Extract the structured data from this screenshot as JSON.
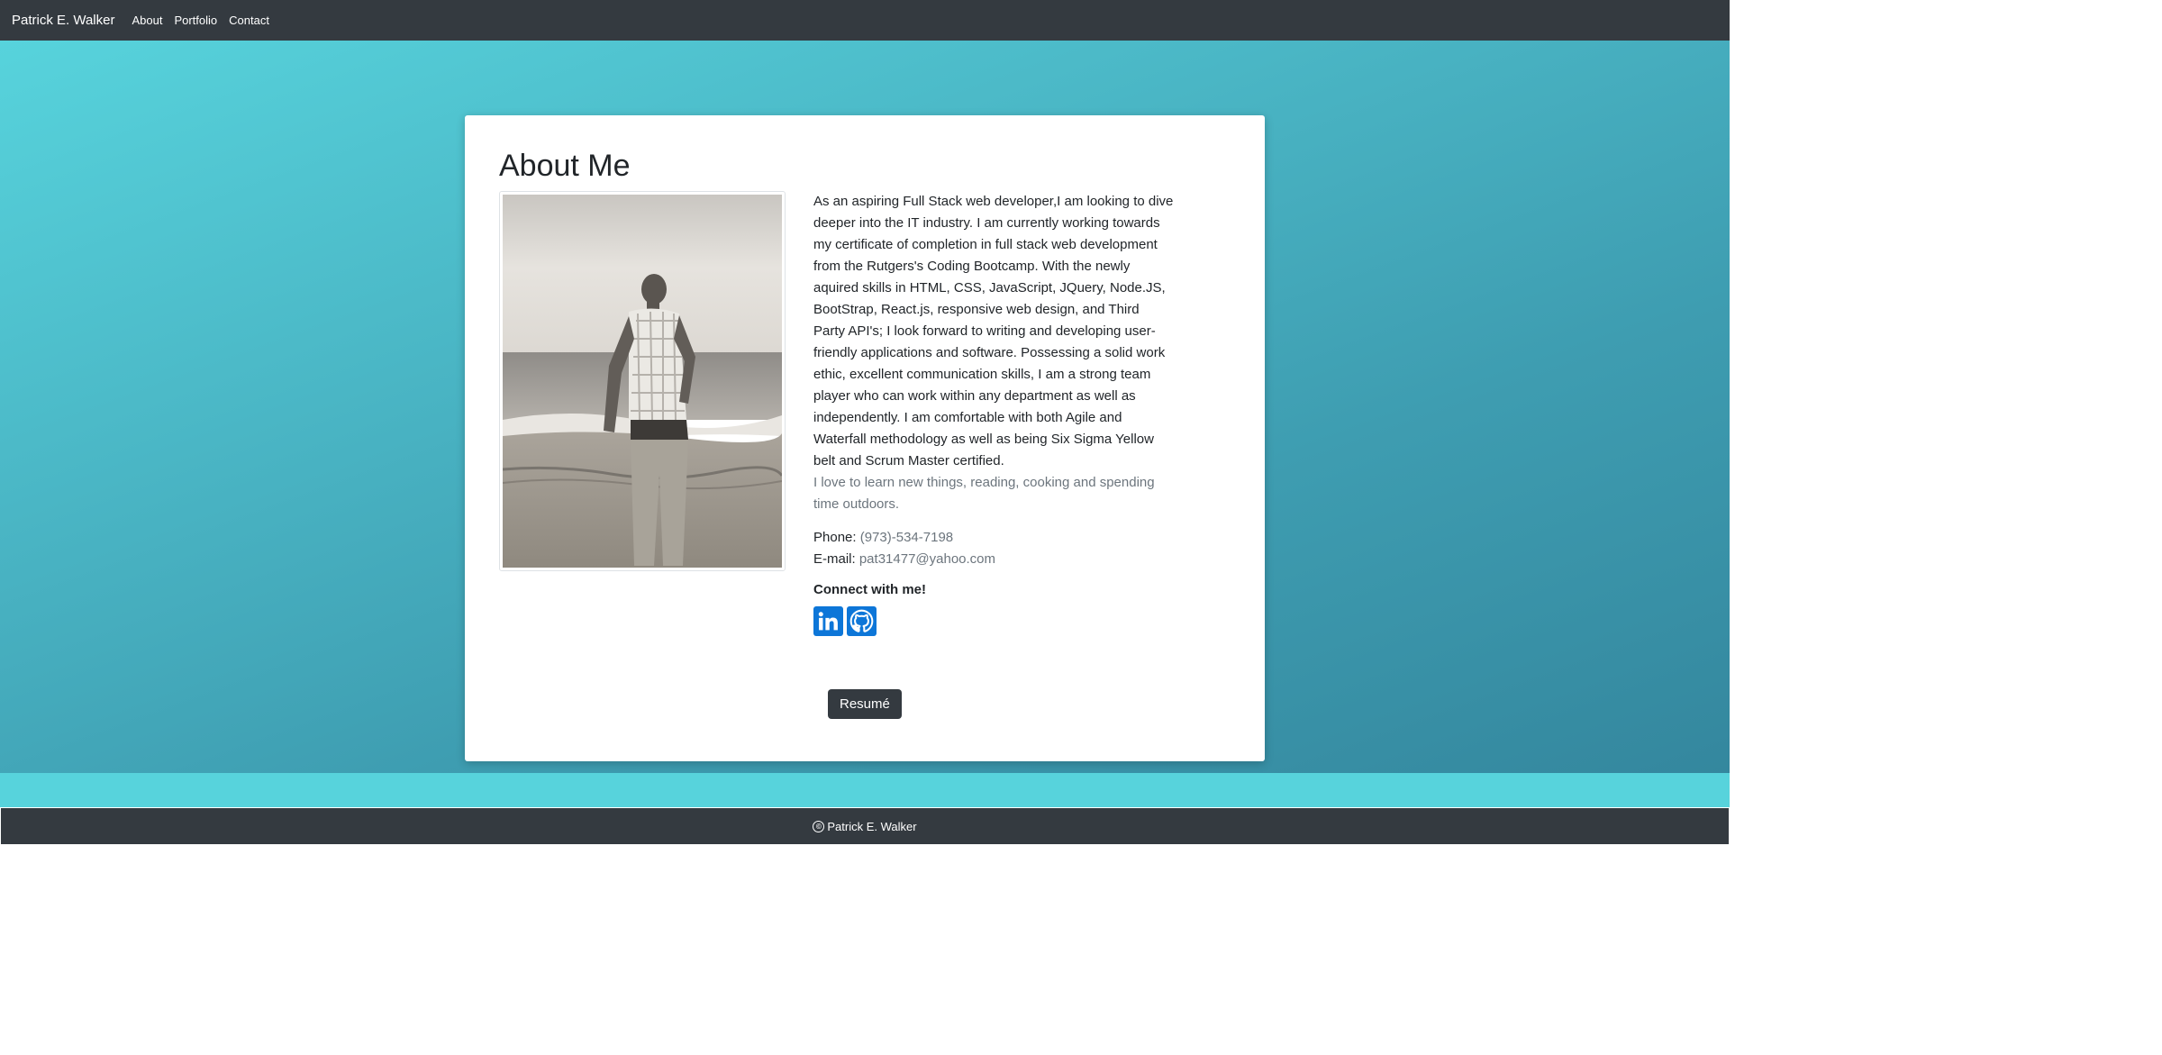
{
  "nav": {
    "brand": "Patrick E. Walker",
    "links": [
      "About",
      "Portfolio",
      "Contact"
    ]
  },
  "about": {
    "title": "About Me",
    "photo_alt": "Patrick E. Walker on the beach",
    "bio": "As an aspiring Full Stack web developer,I am looking to dive deeper into the IT industry. I am currently working towards my certificate of completion in full stack web development from the Rutgers's Coding Bootcamp. With the newly aquired skills in HTML, CSS, JavaScript, JQuery, Node.JS, BootStrap, React.js, responsive web design, and Third Party API's; I look forward to writing and developing user-friendly applications and software. Possessing a solid work ethic, excellent communication skills, I am a strong team player who can work within any department as well as independently. I am comfortable with both Agile and Waterfall methodology as well as being Six Sigma Yellow belt and Scrum Master certified.",
    "hobbies": "I love to learn new things, reading, cooking and spending time outdoors.",
    "phone_label": "Phone:",
    "phone": "(973)-534-7198",
    "email_label": "E-mail:",
    "email": "pat31477@yahoo.com",
    "connect": "Connect with me!",
    "social": [
      {
        "icon": "linkedin-icon"
      },
      {
        "icon": "github-icon"
      }
    ],
    "resume_button": "Resumé"
  },
  "footer": {
    "text": "Patrick E. Walker",
    "copyright_icon": "©"
  },
  "colors": {
    "navbar": "#343a40",
    "hero_gradient_start": "#57d3dc",
    "hero_gradient_end": "#34879e",
    "social_blue": "#0d76d8"
  }
}
